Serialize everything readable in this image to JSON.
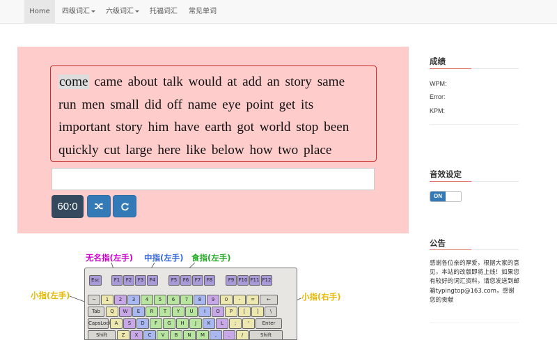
{
  "nav": {
    "items": [
      {
        "label": "Home",
        "active": true,
        "dropdown": false
      },
      {
        "label": "四级词汇",
        "active": false,
        "dropdown": true
      },
      {
        "label": "六级词汇",
        "active": false,
        "dropdown": true
      },
      {
        "label": "托福词汇",
        "active": false,
        "dropdown": false
      },
      {
        "label": "常见单词",
        "active": false,
        "dropdown": false
      }
    ]
  },
  "typing": {
    "words": [
      "come",
      "came",
      "about",
      "talk",
      "would",
      "at",
      "add",
      "an",
      "story",
      "same",
      "run",
      "men",
      "small",
      "did",
      "off",
      "name",
      "eye",
      "point",
      "get",
      "its",
      "important",
      "story",
      "him",
      "have",
      "earth",
      "got",
      "world",
      "stop",
      "been",
      "quickly",
      "cut",
      "large",
      "here",
      "like",
      "below",
      "how",
      "two",
      "place"
    ],
    "current_index": 0,
    "input_value": "",
    "timer": "60:0",
    "shuffle_icon": "shuffle-icon",
    "refresh_icon": "refresh-icon"
  },
  "keyboard_guide": {
    "label_ring_left": "无名指(左手)",
    "label_middle_left": "中指(左手)",
    "label_index_left": "食指(左手)",
    "label_pinky_left": "小指(左手)",
    "label_pinky_right": "小指(右手)",
    "keys": {
      "row_fn": [
        "Esc",
        "F1",
        "F2",
        "F3",
        "F4",
        "F5",
        "F6",
        "F7",
        "F8",
        "F9",
        "F10",
        "F11",
        "F12"
      ],
      "row_num": [
        "~",
        "1",
        "2",
        "3",
        "4",
        "5",
        "6",
        "7",
        "8",
        "9",
        "0",
        "-",
        "=",
        "←"
      ],
      "row_q": [
        "Tab",
        "Q",
        "W",
        "E",
        "R",
        "T",
        "Y",
        "U",
        "I",
        "O",
        "P",
        "[",
        "]",
        "\\"
      ],
      "row_a": [
        "CapsLock",
        "A",
        "S",
        "D",
        "F",
        "G",
        "H",
        "J",
        "K",
        "L",
        ";",
        "'",
        "Enter"
      ],
      "row_z": [
        "Shift",
        "Z",
        "X",
        "C",
        "V",
        "B",
        "N",
        "M",
        ",",
        ".",
        "/",
        "Shift"
      ]
    }
  },
  "sidebar": {
    "score": {
      "title": "成绩",
      "wpm_label": "WPM:",
      "error_label": "Error:",
      "kpm_label": "KPM:"
    },
    "sound": {
      "title": "音效设定",
      "toggle_label": "ON",
      "toggle_state": "on"
    },
    "notice": {
      "title": "公告",
      "text": "感谢各位亲的厚爱，根据大家的意见，本站的改版即将上线！如果您有较好的词汇资料，请您发送到邮箱typingtop@163.com，感谢您的贡献"
    }
  },
  "colors": {
    "panel_bg": "#ffcccc",
    "primary": "#337ab7",
    "timer_bg": "#34495e",
    "ring_label": "#cc00cc",
    "middle_label": "#3366dd",
    "index_label": "#22aa22",
    "pinky_label": "#e6b800"
  }
}
